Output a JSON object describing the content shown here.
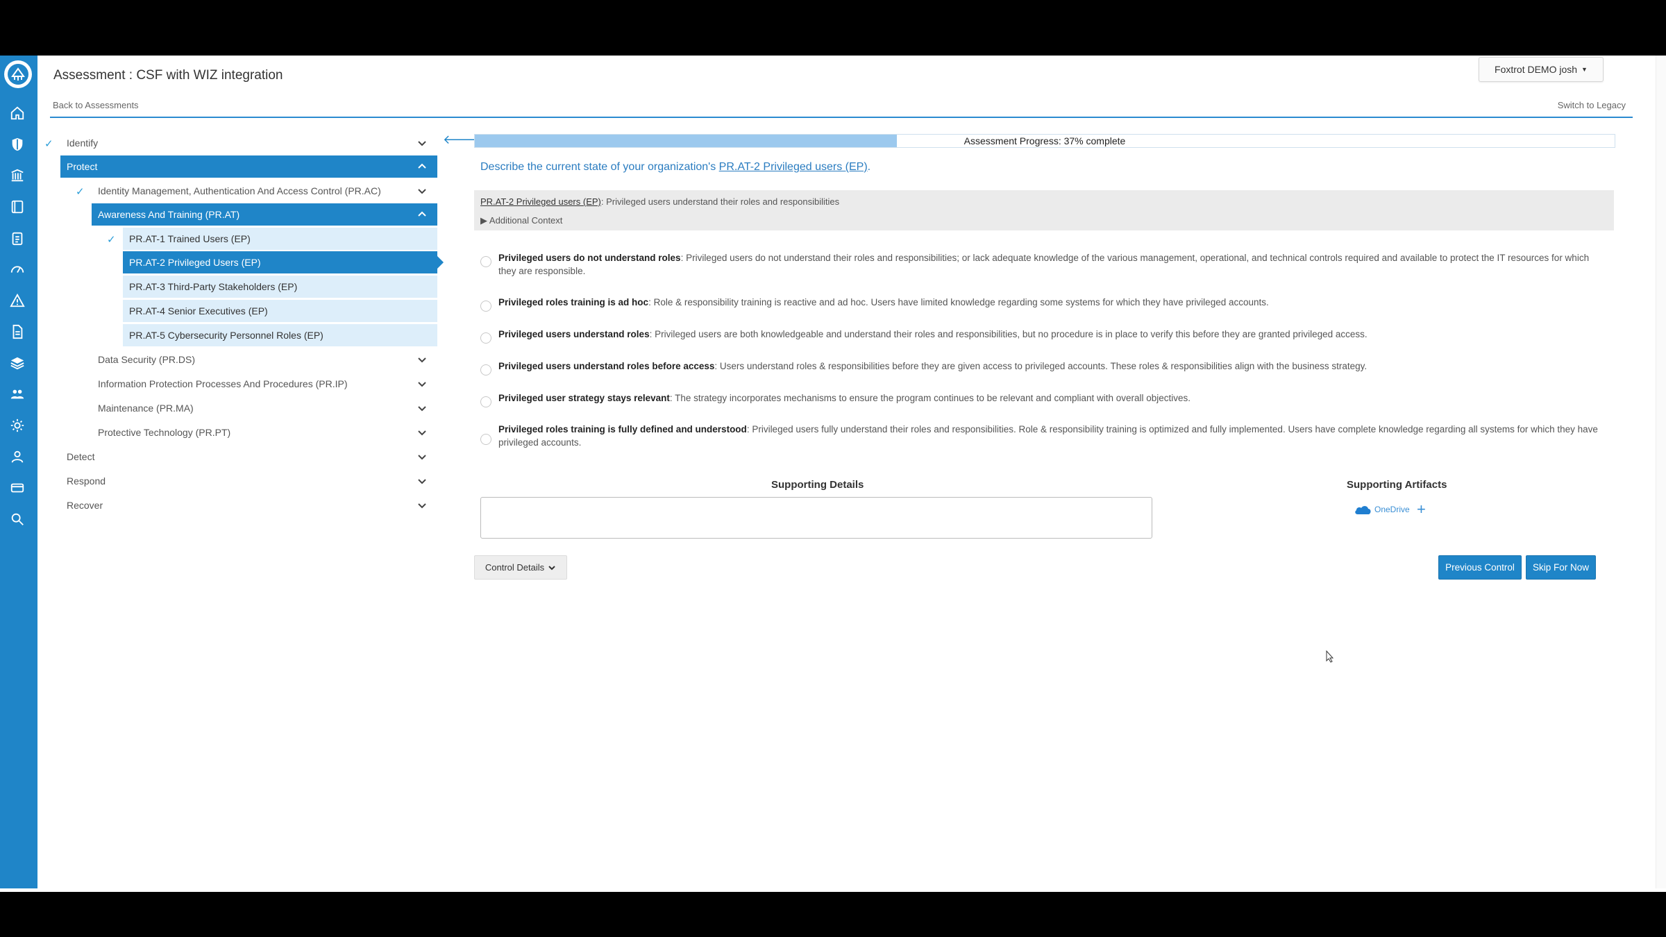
{
  "header": {
    "title": "Assessment : CSF with WIZ integration",
    "back_link": "Back to Assessments",
    "legacy_link": "Switch to Legacy",
    "user_menu": "Foxtrot DEMO josh"
  },
  "rail_icons": [
    "home-icon",
    "shield-icon",
    "library-icon",
    "book-icon",
    "clipboard-icon",
    "dashboard-icon",
    "warning-icon",
    "document-icon",
    "layers-icon",
    "users-icon",
    "gear-icon",
    "user-icon",
    "card-icon",
    "search-icon"
  ],
  "tree": {
    "identify": "Identify",
    "protect": "Protect",
    "pr_ac": "Identity Management, Authentication And Access Control (PR.AC)",
    "pr_at": "Awareness And Training (PR.AT)",
    "pr_at_1": "PR.AT-1 Trained Users (EP)",
    "pr_at_2": "PR.AT-2 Privileged Users (EP)",
    "pr_at_3": "PR.AT-3 Third-Party Stakeholders (EP)",
    "pr_at_4": "PR.AT-4 Senior Executives (EP)",
    "pr_at_5": "PR.AT-5 Cybersecurity Personnel Roles (EP)",
    "pr_ds": "Data Security (PR.DS)",
    "pr_ip": "Information Protection Processes And Procedures (PR.IP)",
    "pr_ma": "Maintenance (PR.MA)",
    "pr_pt": "Protective Technology (PR.PT)",
    "detect": "Detect",
    "respond": "Respond",
    "recover": "Recover"
  },
  "progress": {
    "label": "Assessment Progress: 37% complete",
    "value": 0.37
  },
  "question": {
    "prefix": "Describe the current state of your organization's ",
    "link": "PR.AT-2 Privileged users (EP)",
    "suffix": "."
  },
  "description": {
    "label": "PR.AT-2 Privileged users (EP)",
    "text": ": Privileged users understand their roles and responsibilities",
    "additional_context": "▶ Additional Context"
  },
  "options": [
    {
      "title": "Privileged users do not understand roles",
      "text": ": Privileged users do not understand their roles and responsibilities; or lack adequate knowledge of the various management, operational, and technical controls required and available to protect the IT resources for which they are responsible."
    },
    {
      "title": "Privileged roles training is ad hoc",
      "text": ": Role & responsibility training is reactive and ad hoc. Users have limited knowledge regarding some systems for which they have privileged accounts."
    },
    {
      "title": "Privileged users understand roles",
      "text": ": Privileged users are both knowledgeable and understand their roles and responsibilities, but no procedure is in place to verify this before they are granted privileged access."
    },
    {
      "title": "Privileged users understand roles before access",
      "text": ": Users understand roles & responsibilities before they are given access to privileged accounts. These roles & responsibilities align with the business strategy."
    },
    {
      "title": "Privileged user strategy stays relevant",
      "text": ": The strategy incorporates mechanisms to ensure the program continues to be relevant and compliant with overall objectives."
    },
    {
      "title": "Privileged roles training is fully defined and understood",
      "text": ": Privileged users fully understand their roles and responsibilities. Role & responsibility training is optimized and fully implemented. Users have complete knowledge regarding all systems for which they have privileged accounts."
    }
  ],
  "supporting": {
    "details_title": "Supporting Details",
    "artifacts_title": "Supporting Artifacts",
    "onedrive": "OneDrive",
    "add": "+"
  },
  "buttons": {
    "control_details": "Control Details",
    "previous": "Previous Control",
    "skip": "Skip For Now"
  },
  "colors": {
    "brand": "#1f85c8",
    "progress_fill": "#9cc9ee",
    "sub_highlight": "#ddeefa"
  }
}
